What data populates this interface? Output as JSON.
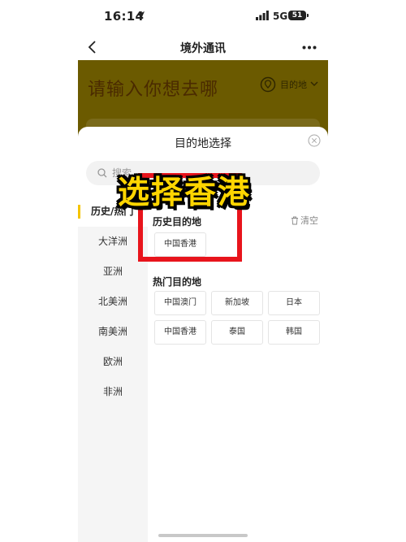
{
  "status_bar": {
    "time": "16:14",
    "network": "5G",
    "battery": "51"
  },
  "nav": {
    "title": "境外通讯"
  },
  "background_page": {
    "prompt": "请输入你想去哪",
    "destination_label": "目的地"
  },
  "sheet": {
    "title": "目的地选择",
    "search_placeholder": "搜索",
    "categories": [
      {
        "label": "历史/热门"
      },
      {
        "label": "大洋洲"
      },
      {
        "label": "亚洲"
      },
      {
        "label": "北美洲"
      },
      {
        "label": "南美洲"
      },
      {
        "label": "欧洲"
      },
      {
        "label": "非洲"
      }
    ],
    "history": {
      "title": "历史目的地",
      "clear_label": "清空",
      "items": [
        "中国香港"
      ]
    },
    "hot": {
      "title": "热门目的地",
      "items": [
        "中国澳门",
        "新加坡",
        "日本",
        "中国香港",
        "泰国",
        "韩国"
      ]
    }
  },
  "annotation": {
    "text": "选择香港",
    "color": "#ffd500",
    "box_color": "#e8141c"
  },
  "colors": {
    "accent": "#f5c400",
    "dim_header": "#6b5a00"
  }
}
